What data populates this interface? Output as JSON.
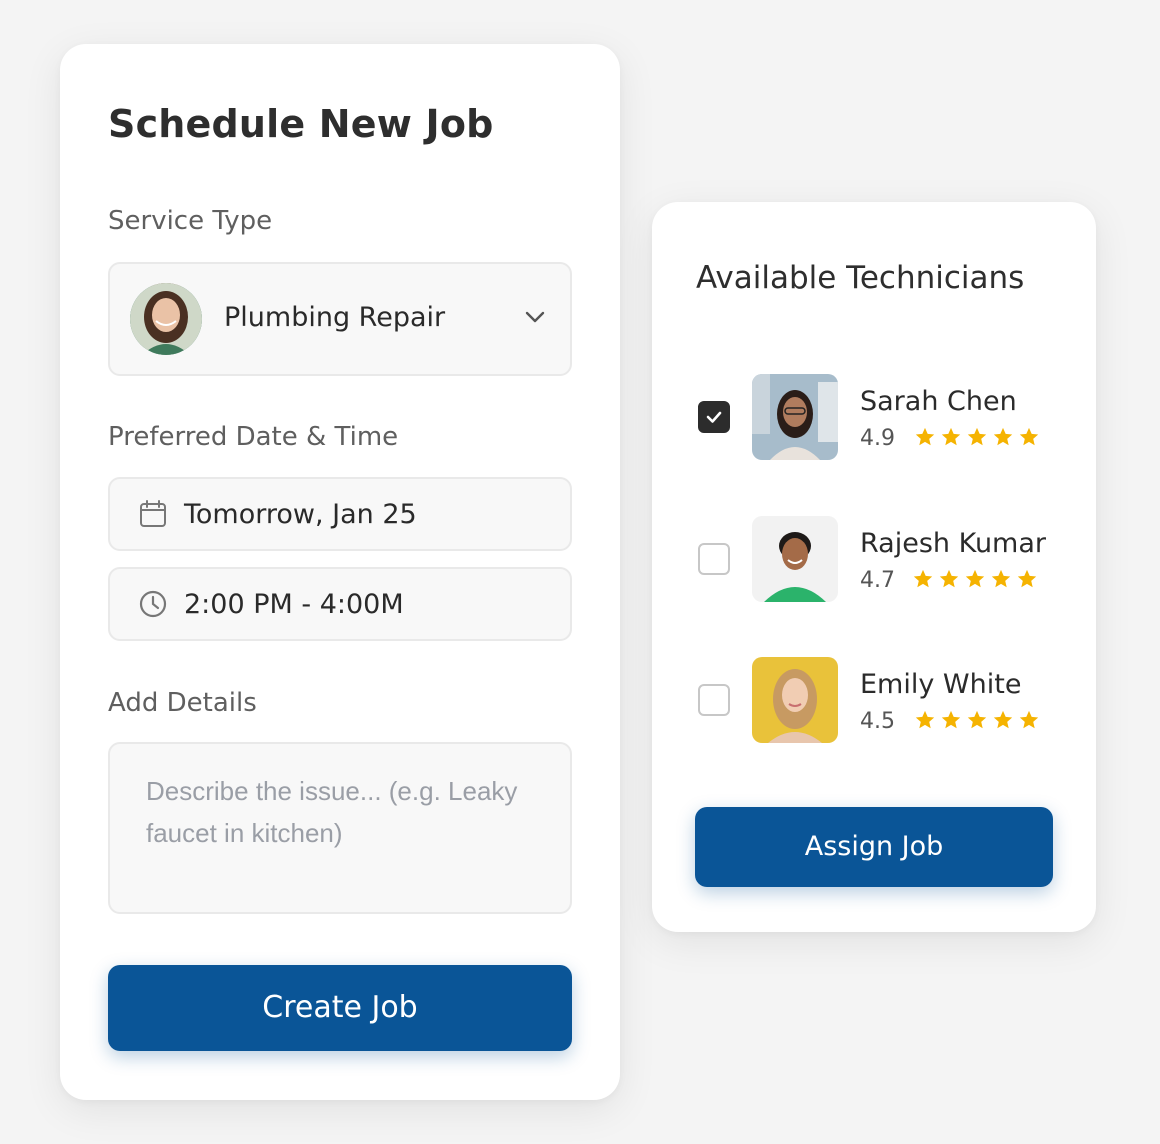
{
  "schedule": {
    "title": "Schedule New Job",
    "service_label": "Service Type",
    "service_value": "Plumbing Repair",
    "date_label": "Preferred Date & Time",
    "date_value": "Tomorrow, Jan 25",
    "time_value": "2:00 PM - 4:00M",
    "details_label": "Add Details",
    "details_placeholder": "Describe the issue... (e.g. Leaky faucet in kitchen)",
    "create_button": "Create Job"
  },
  "technicians": {
    "title": "Available Technicians",
    "items": [
      {
        "name": "Sarah Chen",
        "rating": "4.9",
        "stars": 5,
        "checked": true
      },
      {
        "name": "Rajesh Kumar",
        "rating": "4.7",
        "stars": 5,
        "checked": false
      },
      {
        "name": "Emily White",
        "rating": "4.5",
        "stars": 5,
        "checked": false
      }
    ],
    "assign_button": "Assign Job"
  },
  "colors": {
    "primary": "#0a5597",
    "star": "#f5b301",
    "checkbox_checked": "#2c2c2c"
  },
  "icons": {
    "date": "calendar-icon",
    "time": "clock-icon",
    "select": "chevron-down-icon",
    "check": "checkmark-icon",
    "rating": "star-icon"
  }
}
